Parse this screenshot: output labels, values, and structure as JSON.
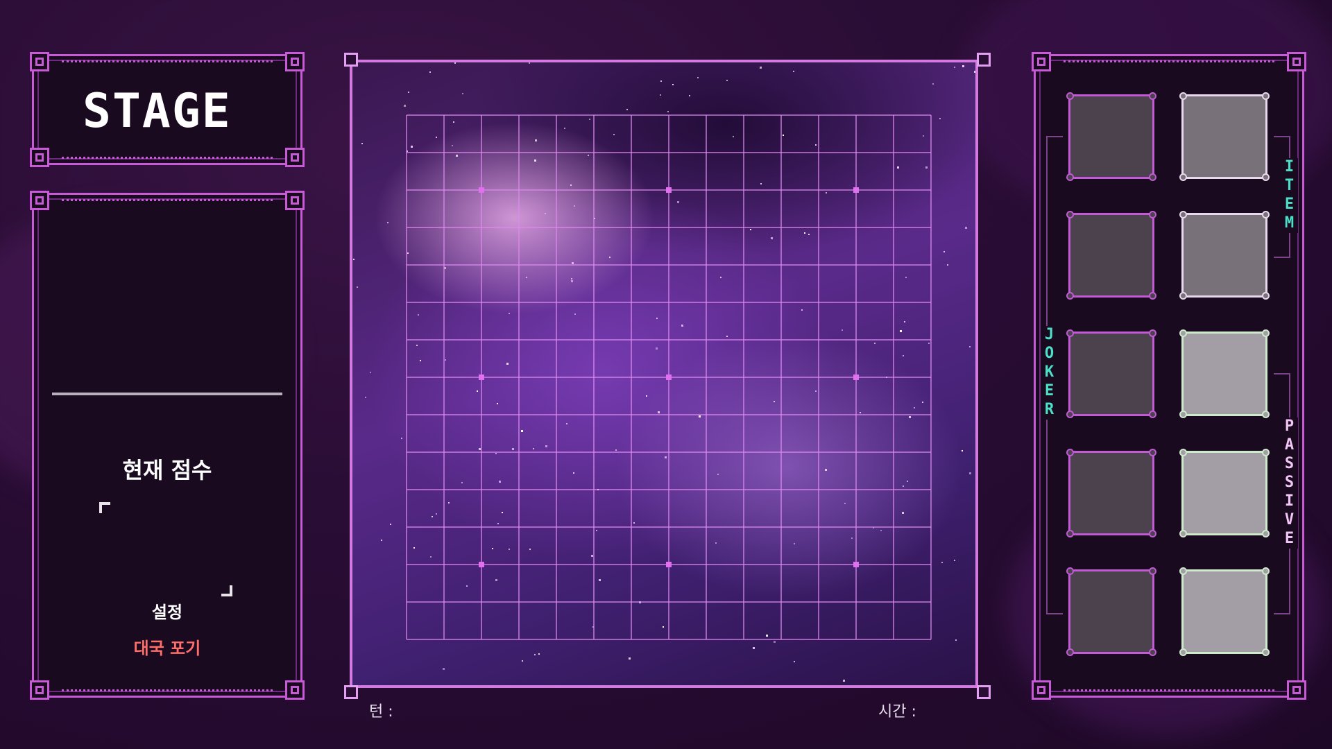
{
  "stage_panel": {
    "title": "STAGE"
  },
  "info_panel": {
    "score_label": "현재 점수",
    "settings_label": "설정",
    "resign_label": "대국 포기"
  },
  "board": {
    "grid_lines": 15,
    "turn_label": "턴 :",
    "time_label": "시간 :"
  },
  "side_panel": {
    "item_label": "ITEM",
    "joker_label": "JOKER",
    "passive_label": "PASSIVE",
    "slots": [
      {
        "id": "joker-1",
        "style": "dark"
      },
      {
        "id": "item-1",
        "style": "mid"
      },
      {
        "id": "joker-2",
        "style": "dark"
      },
      {
        "id": "item-2",
        "style": "mid"
      },
      {
        "id": "joker-3",
        "style": "dark"
      },
      {
        "id": "passive-1",
        "style": "light"
      },
      {
        "id": "joker-4",
        "style": "dark"
      },
      {
        "id": "passive-2",
        "style": "light"
      },
      {
        "id": "joker-5",
        "style": "dark"
      },
      {
        "id": "passive-3",
        "style": "light"
      }
    ]
  },
  "colors": {
    "frame": "#c85ad8",
    "grid": "#e089f0",
    "item_text": "#4de0c8",
    "joker_text": "#4de0c8",
    "passive_text": "#f2c6f6",
    "resign_text": "#ff6f6a"
  }
}
